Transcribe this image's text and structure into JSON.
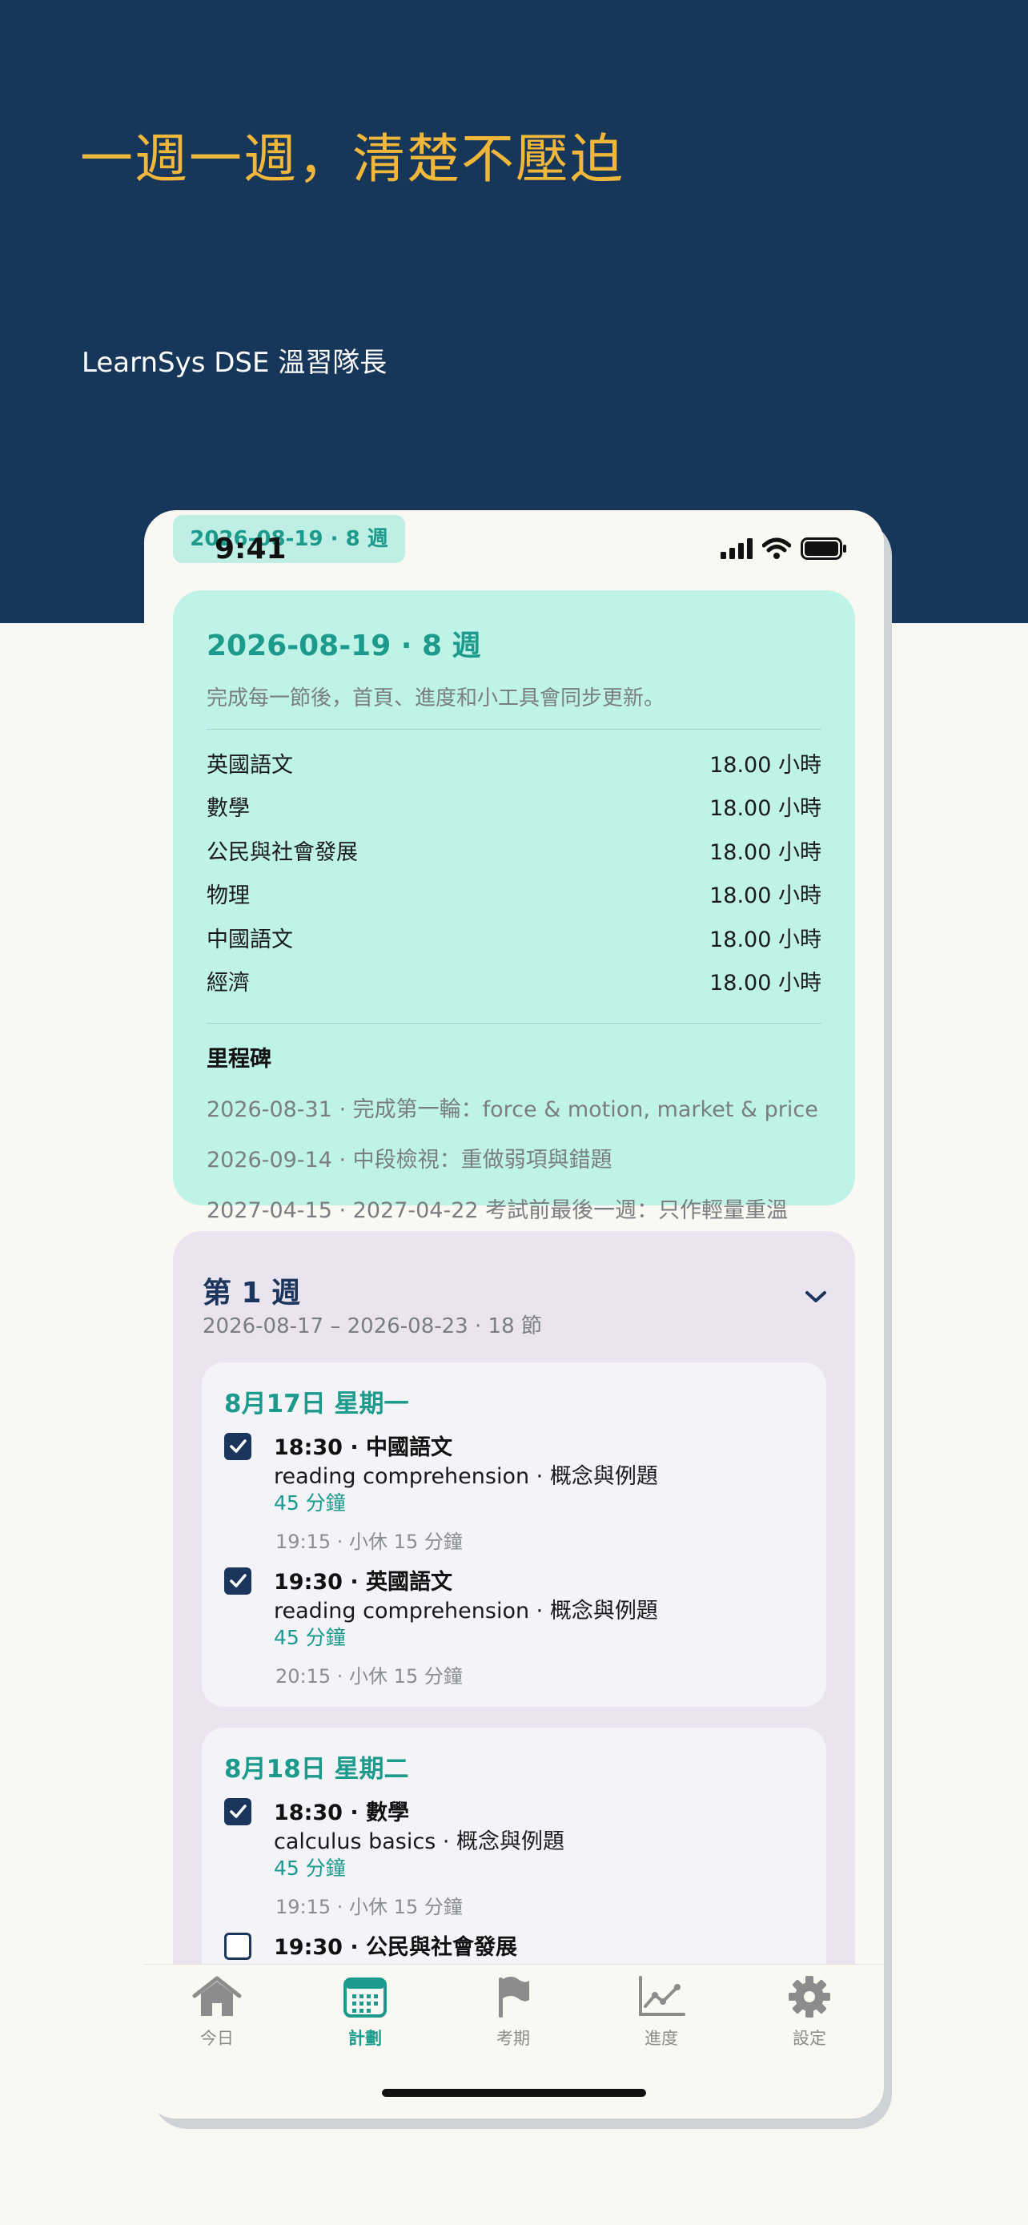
{
  "hero": {
    "title": "一週一週，清楚不壓迫",
    "subtitle": "LearnSys DSE 溫習隊長"
  },
  "status_bar": {
    "time": "9:41",
    "pill_label": "2026-08-19 · 8 週"
  },
  "summary": {
    "title": "2026-08-19 · 8 週",
    "description": "完成每一節後，首頁、進度和小工具會同步更新。",
    "subjects": [
      {
        "name": "英國語文",
        "hours": "18.00 小時"
      },
      {
        "name": "數學",
        "hours": "18.00 小時"
      },
      {
        "name": "公民與社會發展",
        "hours": "18.00 小時"
      },
      {
        "name": "物理",
        "hours": "18.00 小時"
      },
      {
        "name": "中國語文",
        "hours": "18.00 小時"
      },
      {
        "name": "經濟",
        "hours": "18.00 小時"
      }
    ],
    "milestones_heading": "里程碑",
    "milestones": [
      "2026-08-31 · 完成第一輪：force & motion, market & price",
      "2026-09-14 · 中段檢視：重做弱項與錯題",
      "2027-04-15 · 2027-04-22 考試前最後一週：只作輕量重溫"
    ]
  },
  "week": {
    "title": "第 1 週",
    "range": "2026-08-17 – 2026-08-23 · 18 節",
    "days": [
      {
        "title": "8月17日 星期一",
        "sessions": [
          {
            "checked": true,
            "title": "18:30 · 中國語文",
            "topic": "reading comprehension · 概念與例題",
            "duration": "45 分鐘",
            "break": "19:15 · 小休 15 分鐘"
          },
          {
            "checked": true,
            "title": "19:30 · 英國語文",
            "topic": "reading comprehension · 概念與例題",
            "duration": "45 分鐘",
            "break": "20:15 · 小休 15 分鐘"
          }
        ]
      },
      {
        "title": "8月18日 星期二",
        "sessions": [
          {
            "checked": true,
            "title": "18:30 · 數學",
            "topic": "calculus basics · 概念與例題",
            "duration": "45 分鐘",
            "break": "19:15 · 小休 15 分鐘"
          },
          {
            "checked": false,
            "title": "19:30 · 公民與社會發展",
            "topic": "",
            "duration": "",
            "break": ""
          }
        ]
      }
    ]
  },
  "tabs": [
    {
      "label": "今日",
      "icon": "home-icon",
      "active": false
    },
    {
      "label": "計劃",
      "icon": "calendar-icon",
      "active": true
    },
    {
      "label": "考期",
      "icon": "flag-icon",
      "active": false
    },
    {
      "label": "進度",
      "icon": "chart-icon",
      "active": false
    },
    {
      "label": "設定",
      "icon": "gear-icon",
      "active": false
    }
  ],
  "colors": {
    "navy": "#16365a",
    "gold": "#f1b73a",
    "teal": "#1c9a8c",
    "mint": "#bff3e8",
    "lavender": "#e9e4ef"
  }
}
